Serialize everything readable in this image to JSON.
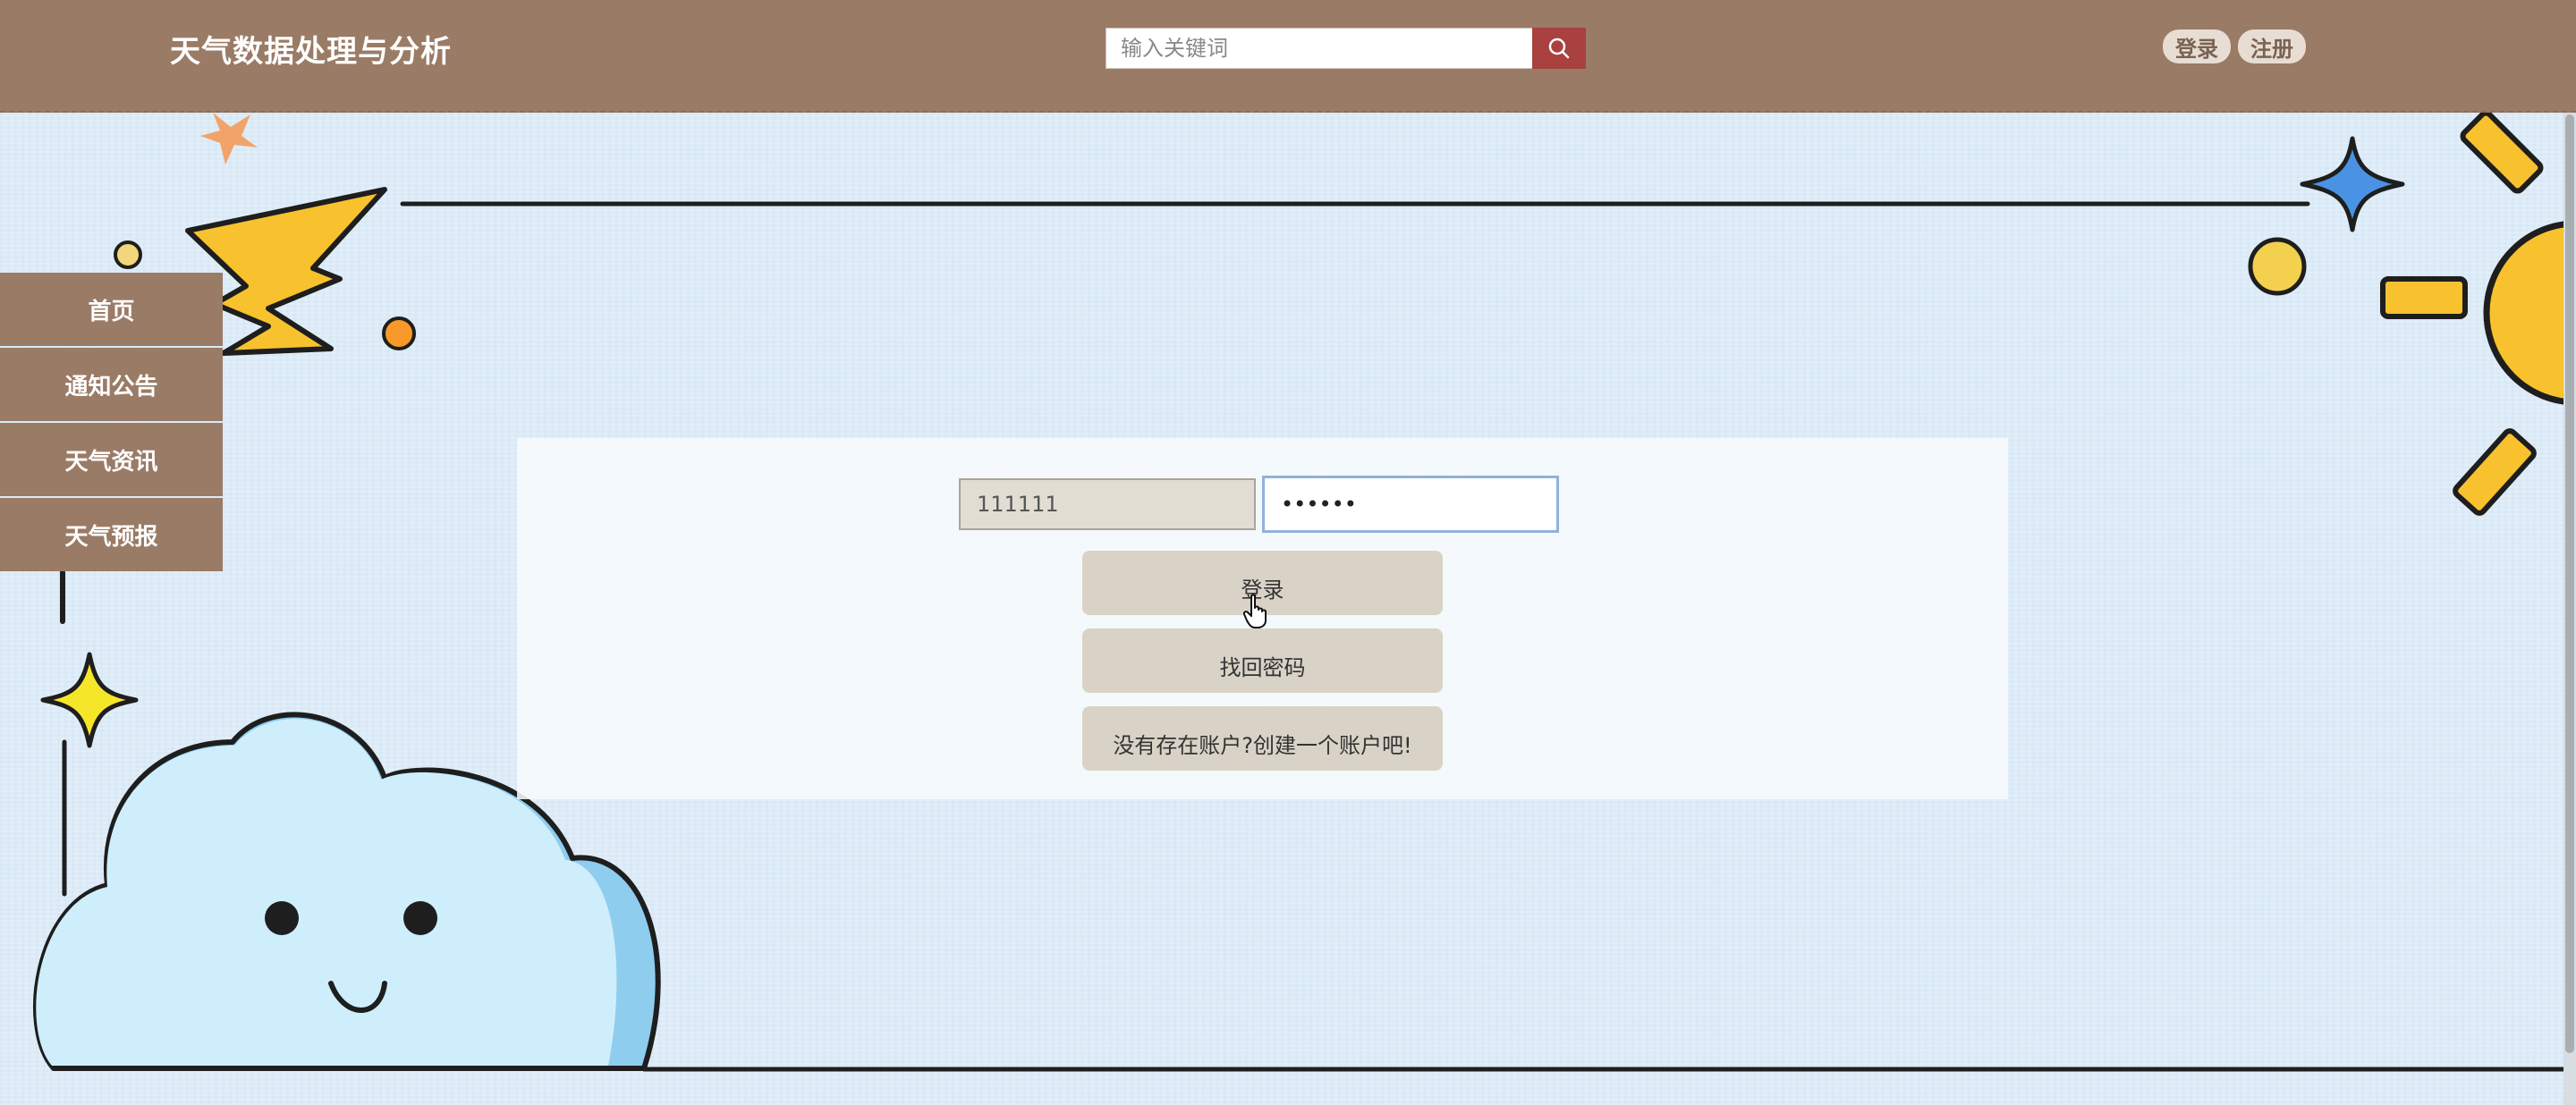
{
  "header": {
    "brand": "天气数据处理与分析",
    "search_placeholder": "输入关键词",
    "login_label": "登录",
    "register_label": "注册"
  },
  "sidebar": {
    "items": [
      {
        "label": "首页"
      },
      {
        "label": "通知公告"
      },
      {
        "label": "天气资讯"
      },
      {
        "label": "天气预报"
      }
    ]
  },
  "login_form": {
    "username_value": "111111",
    "password_value": "••••••",
    "login_button": "登录",
    "find_password_button": "找回密码",
    "create_account_button": "没有存在账户?创建一个账户吧!"
  },
  "icons": {
    "search": "search-icon",
    "cursor": "hand-cursor-icon"
  },
  "colors": {
    "header_bg": "#9a7b66",
    "search_btn": "#a8413f",
    "button_bg": "#d8d3c6",
    "page_bg": "#dcebf7"
  }
}
